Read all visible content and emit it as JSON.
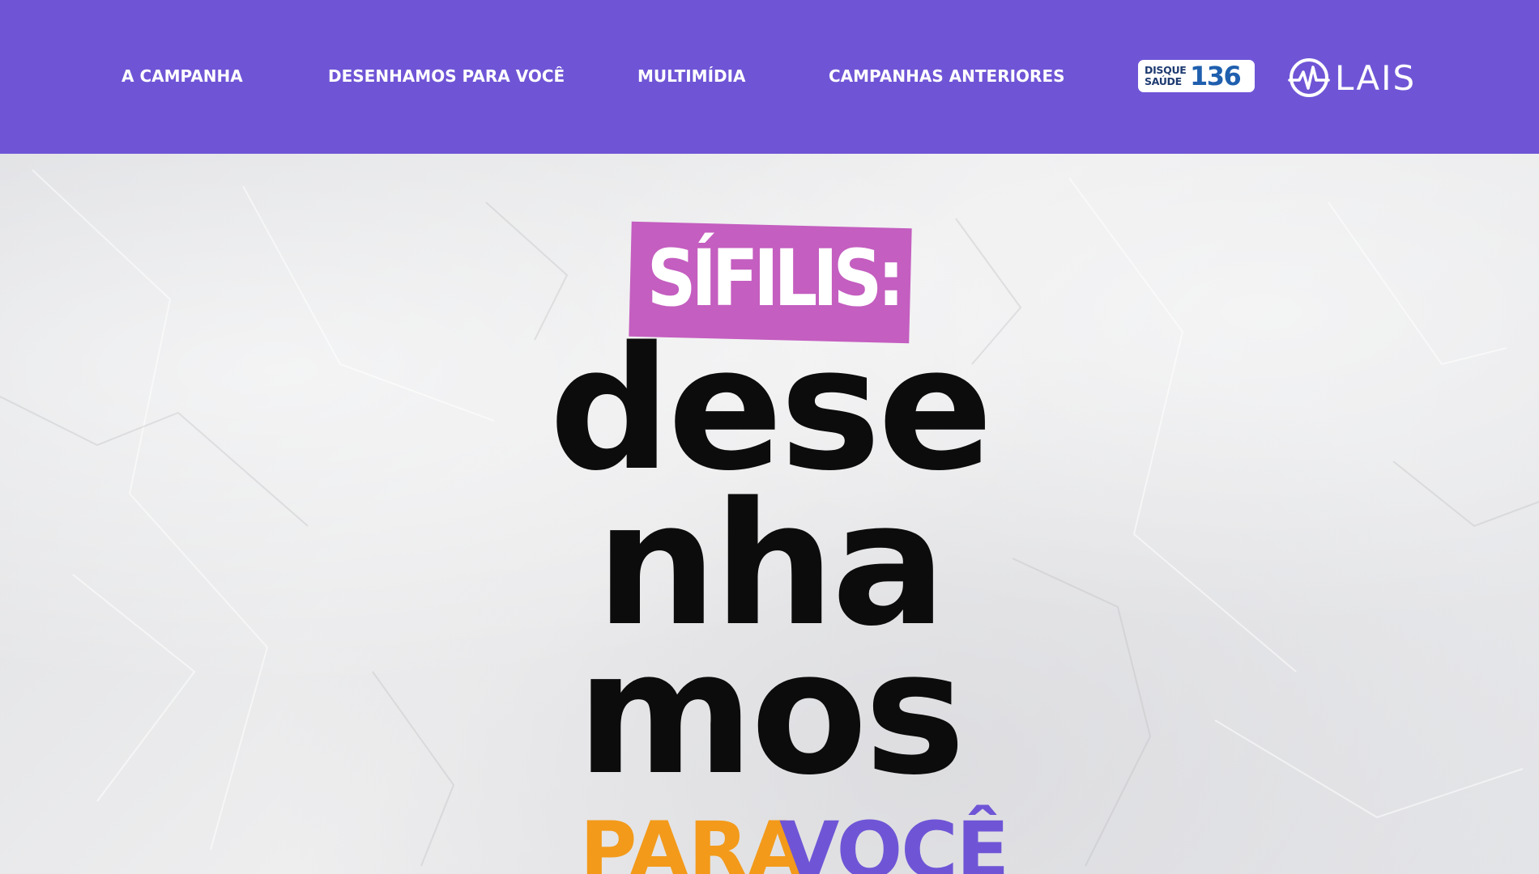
{
  "header": {
    "background_color": "#6f55d6",
    "nav": [
      {
        "label": "A CAMPANHA"
      },
      {
        "label": "DESENHAMOS PARA VOCÊ"
      },
      {
        "label": "MULTIMÍDIA"
      },
      {
        "label": "CAMPANHAS ANTERIORES"
      }
    ],
    "disque_saude": {
      "word1": "DISQUE",
      "word2": "SAÚDE",
      "number": "136",
      "icon": "disque-saude-136-logo"
    },
    "lais": {
      "text": "LAIS",
      "icon": "heartbeat-logo-icon"
    }
  },
  "hero": {
    "tag": "SÍFILIS:",
    "tag_color": "#c45ec0",
    "lines": [
      "dese",
      "nha",
      "mos"
    ],
    "para": "PARA",
    "para_color": "#f39a1a",
    "voce": "VOCÊ",
    "voce_color": "#6f55d6"
  }
}
